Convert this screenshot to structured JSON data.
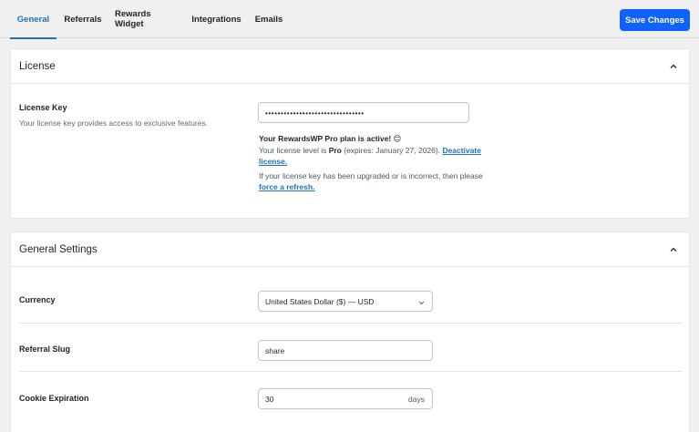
{
  "tabs": [
    {
      "label": "General",
      "active": true
    },
    {
      "label": "Referrals",
      "active": false
    },
    {
      "label": "Rewards Widget",
      "active": false
    },
    {
      "label": "Integrations",
      "active": false
    },
    {
      "label": "Emails",
      "active": false
    }
  ],
  "toolbar": {
    "save_label": "Save Changes"
  },
  "license": {
    "title": "License",
    "key_label": "License Key",
    "key_description": "Your license key provides access to exclusive features.",
    "key_value": "••••••••••••••••••••••••••••••••",
    "status_heading": "Your RewardsWP Pro plan is active! 😊",
    "level_prefix": "Your license level is ",
    "level_value": "Pro",
    "level_suffix": " (expires: January 27, 2026). ",
    "deactivate_link": "Deactivate license.",
    "refresh_prefix": "If your license key has been upgraded or is incorrect, then please ",
    "refresh_link": "force a refresh."
  },
  "general_settings": {
    "title": "General Settings",
    "currency_label": "Currency",
    "currency_value": "United States Dollar ($) — USD",
    "referral_slug_label": "Referral Slug",
    "referral_slug_value": "share",
    "cookie_label": "Cookie Expiration",
    "cookie_value": "30",
    "cookie_unit": "days"
  },
  "colors": {
    "accent": "#2271b1",
    "save_button": "#0f62fe"
  },
  "icons": [
    "chevron-up-icon",
    "chevron-down-icon"
  ]
}
